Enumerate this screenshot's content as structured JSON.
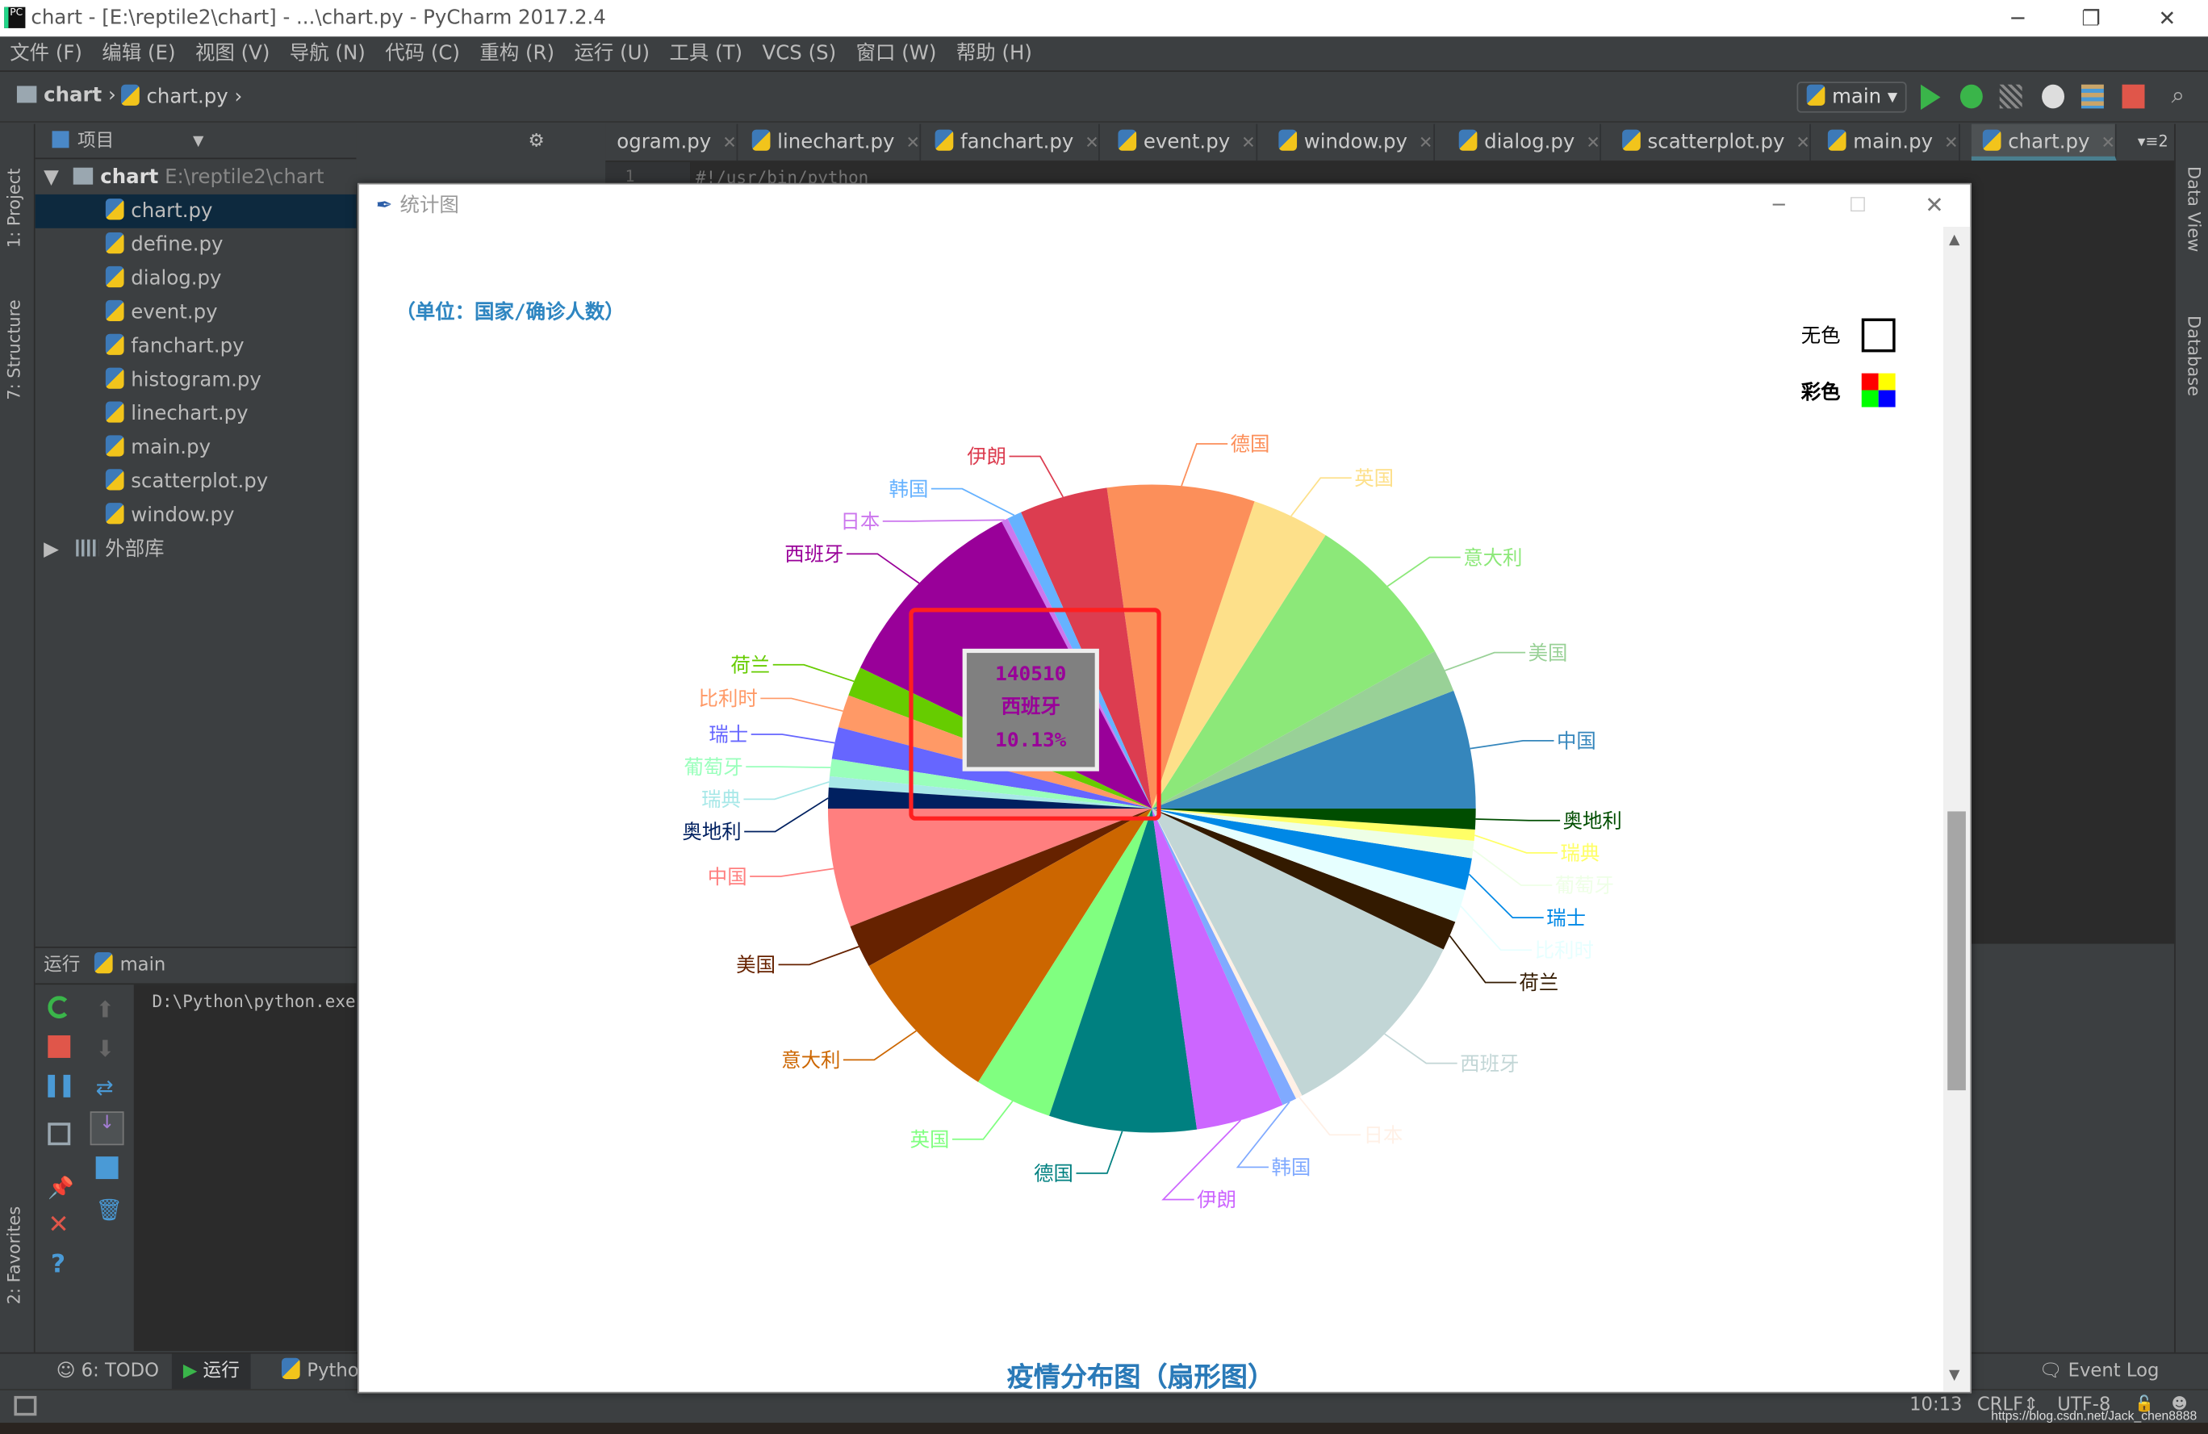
{
  "window": {
    "title": "chart - [E:\\reptile2\\chart] - ...\\chart.py - PyCharm 2017.2.4",
    "app_icon": "PC"
  },
  "menu": [
    "文件 (F)",
    "编辑 (E)",
    "视图 (V)",
    "导航 (N)",
    "代码 (C)",
    "重构 (R)",
    "运行 (U)",
    "工具 (T)",
    "VCS (S)",
    "窗口 (W)",
    "帮助 (H)"
  ],
  "breadcrumb": [
    "chart",
    "chart.py"
  ],
  "run_config": "main",
  "left_stripe": [
    "1: Project",
    "7: Structure",
    "2: Favorites"
  ],
  "right_stripe": [
    "Data View",
    "Database"
  ],
  "project": {
    "header": "项目",
    "root": {
      "name": "chart",
      "path": "E:\\reptile2\\chart"
    },
    "files": [
      "chart.py",
      "define.py",
      "dialog.py",
      "event.py",
      "fanchart.py",
      "histogram.py",
      "linechart.py",
      "main.py",
      "scatterplot.py",
      "window.py"
    ],
    "selected": "chart.py",
    "external": "外部库"
  },
  "tabs": [
    {
      "label": "ogram.py"
    },
    {
      "label": "linechart.py"
    },
    {
      "label": "fanchart.py"
    },
    {
      "label": "event.py"
    },
    {
      "label": "window.py"
    },
    {
      "label": "dialog.py"
    },
    {
      "label": "scatterplot.py"
    },
    {
      "label": "main.py"
    },
    {
      "label": "chart.py",
      "active": true
    }
  ],
  "tabs_overflow": "2",
  "editor": {
    "line_no": "1",
    "code": "#!/usr/bin/python"
  },
  "run_panel": {
    "label": "运行",
    "config": "main",
    "console": "D:\\Python\\python.exe"
  },
  "bottom_tabs": [
    "6: TODO",
    "运行",
    "Pytho"
  ],
  "event_log": "Event Log",
  "status": {
    "position": "10:13",
    "line_sep": "CRLF",
    "encoding": "UTF-8"
  },
  "watermark": "https://blog.csdn.net/Jack_chen8888",
  "dialog": {
    "title": "统计图",
    "unit": "（单位：国家/确诊人数）",
    "legend": [
      {
        "label": "无色",
        "swatch": "empty"
      },
      {
        "label": "彩色",
        "swatch": "four-color",
        "colors": [
          "#ff0000",
          "#ffff00",
          "#00ff00",
          "#0000ff"
        ]
      }
    ],
    "tooltip": {
      "value": "140510",
      "name": "西班牙",
      "percent": "10.13%",
      "highlight_color": "#ff2020"
    },
    "chart_title": "疫情分布图（扇形图）"
  },
  "chart_data": {
    "type": "pie",
    "title": "疫情分布图（扇形图）",
    "categories": [
      "中国",
      "美国",
      "意大利",
      "英国",
      "德国",
      "伊朗",
      "韩国",
      "日本",
      "西班牙",
      "荷兰",
      "比利时",
      "瑞士",
      "葡萄牙",
      "瑞典",
      "奥地利"
    ],
    "series": [
      {
        "values": [
          82000,
          29700,
          109400,
          53600,
          101700,
          60900,
          10000,
          4600,
          140510,
          20400,
          22700,
          22000,
          11900,
          7700,
          14300
        ],
        "colors": [
          "#3586bc",
          "#99d197",
          "#8ce879",
          "#fde08a",
          "#fc8f5a",
          "#dc3d50",
          "#66b2ff",
          "#cc77ee",
          "#990099",
          "#66cc00",
          "#ff9966",
          "#6666ff",
          "#99ffbb",
          "#a8e8e8",
          "#002060"
        ]
      },
      {
        "values": [
          82000,
          29700,
          109400,
          53600,
          101700,
          60900,
          10000,
          4600,
          140510,
          20400,
          22700,
          22000,
          11900,
          7700,
          14300
        ],
        "colors": [
          "#ff7f7f",
          "#662200",
          "#cc6600",
          "#80ff80",
          "#008080",
          "#cc66ff",
          "#80aaff",
          "#fff0e6",
          "#c2d6d6",
          "#331a00",
          "#e6ffff",
          "#0088e6",
          "#eeffe6",
          "#ffff66",
          "#004d00"
        ]
      }
    ],
    "start": "right",
    "direction": "counterclockwise"
  }
}
